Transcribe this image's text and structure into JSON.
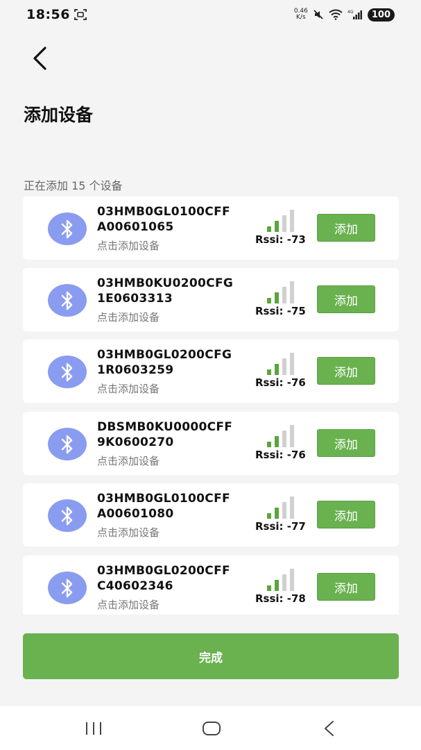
{
  "status_bar": {
    "time": "18:56",
    "net_speed_value": "0.46",
    "net_speed_unit": "K/s",
    "network_type": "4G",
    "battery": "100"
  },
  "header": {
    "title": "添加设备",
    "adding_count": "正在添加 15 个设备"
  },
  "devices": [
    {
      "line1": "03HMB0GL0100CFF",
      "line2": "A00601065",
      "hint": "点击添加设备",
      "rssi": "Rssi: -73",
      "button": "添加"
    },
    {
      "line1": "03HMB0KU0200CFG",
      "line2": "1E0603313",
      "hint": "点击添加设备",
      "rssi": "Rssi: -75",
      "button": "添加"
    },
    {
      "line1": "03HMB0GL0200CFG",
      "line2": "1R0603259",
      "hint": "点击添加设备",
      "rssi": "Rssi: -76",
      "button": "添加"
    },
    {
      "line1": "DBSMB0KU0000CFF",
      "line2": "9K0600270",
      "hint": "点击添加设备",
      "rssi": "Rssi: -76",
      "button": "添加"
    },
    {
      "line1": "03HMB0GL0100CFF",
      "line2": "A00601080",
      "hint": "点击添加设备",
      "rssi": "Rssi: -77",
      "button": "添加"
    },
    {
      "line1": "03HMB0GL0200CFF",
      "line2": "C40602346",
      "hint": "点击添加设备",
      "rssi": "Rssi: -78",
      "button": "添加"
    }
  ],
  "done_button": "完成",
  "colors": {
    "accent_green": "#6ab150",
    "bluetooth_circle": "#8a9cf0",
    "signal_active": "#5aa63c",
    "signal_inactive": "#d0d0d0"
  },
  "icons": {
    "back": "chevron-left-icon",
    "bluetooth": "bluetooth-icon",
    "signal": "signal-bars-icon",
    "nav_recents": "recents-icon",
    "nav_home": "home-icon",
    "nav_back": "back-icon"
  }
}
